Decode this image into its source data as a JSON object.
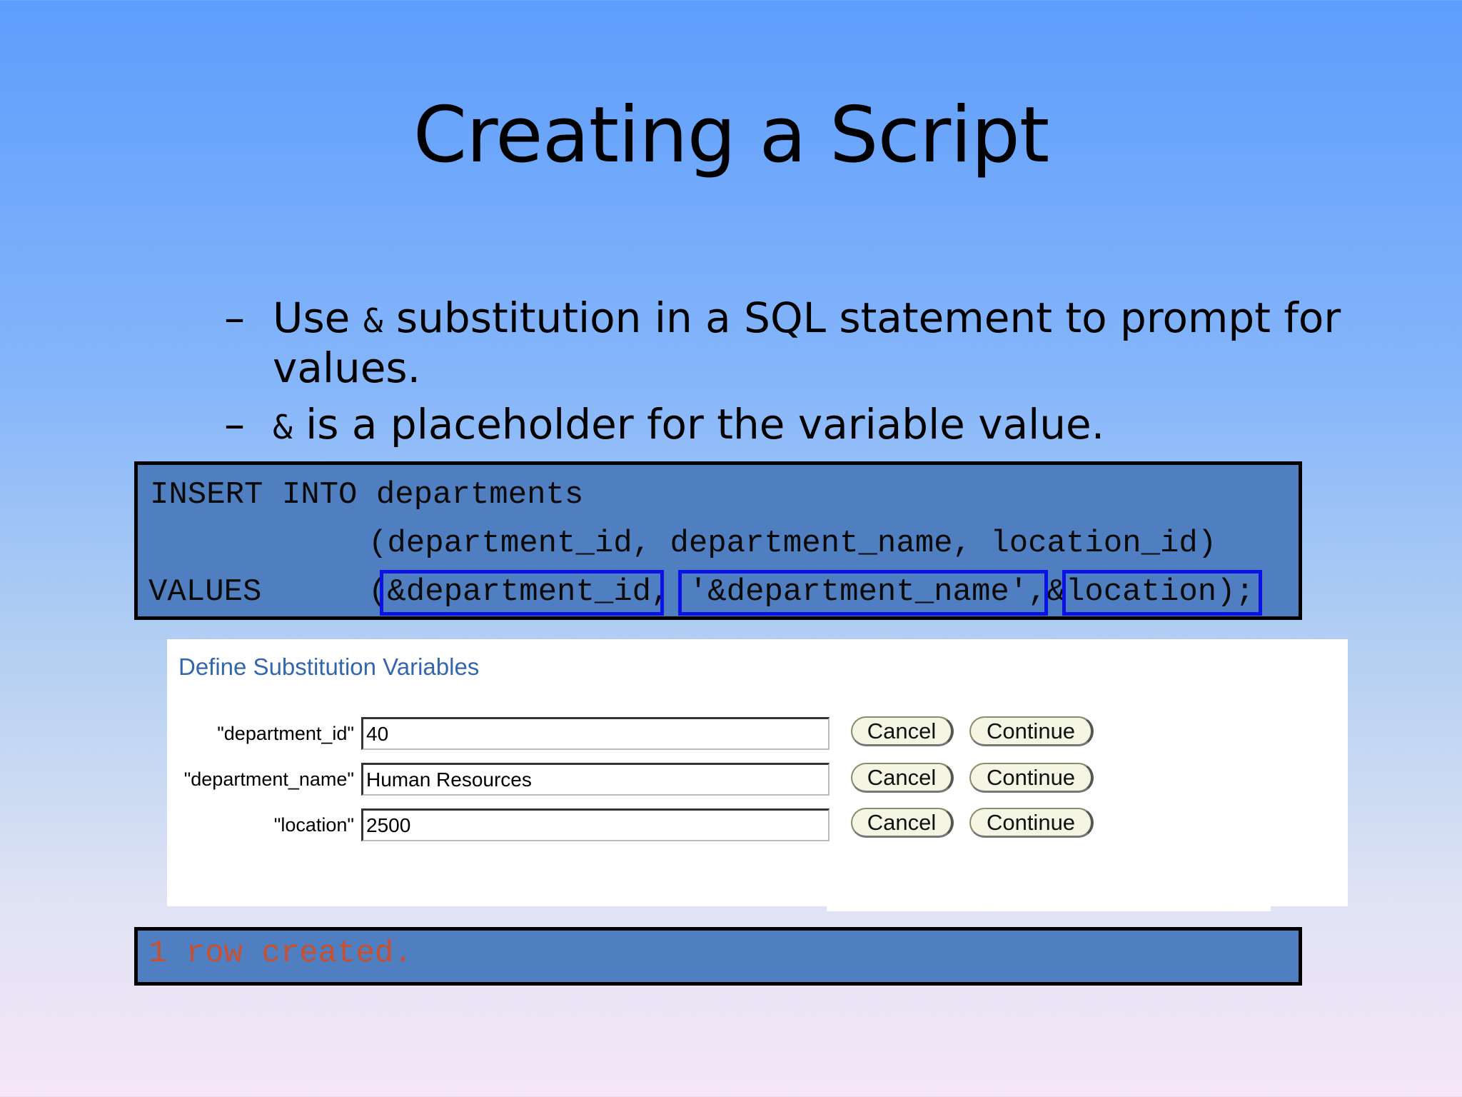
{
  "slide": {
    "title": "Creating a Script",
    "bullets": [
      {
        "dash": "–",
        "before": "Use ",
        "amp": "&",
        "after": " substitution in a SQL statement to prompt for",
        "line2": "values."
      },
      {
        "dash": "–",
        "amp": "&",
        "after": " is a placeholder for the variable value."
      }
    ]
  },
  "code": {
    "line1": "INSERT INTO departments",
    "line2": "(department_id, department_name, location_id)",
    "line3_keyword": "VALUES",
    "line3_values": "(&department_id, '&department_name',&location);"
  },
  "dialog": {
    "title": "Define Substitution Variables",
    "rows": [
      {
        "label": "\"department_id\"",
        "value": "40",
        "cancel": "Cancel",
        "continue": "Continue"
      },
      {
        "label": "\"department_name\"",
        "value": "Human Resources",
        "cancel": "Cancel",
        "continue": "Continue"
      },
      {
        "label": "\"location\"",
        "value": "2500",
        "cancel": "Cancel",
        "continue": "Continue"
      }
    ]
  },
  "result": {
    "text": "1 row created."
  },
  "colors": {
    "highlight_border": "#0a12e6",
    "code_background": "#4f7fc1",
    "result_text": "#c8502e",
    "dialog_title": "#3366aa"
  }
}
